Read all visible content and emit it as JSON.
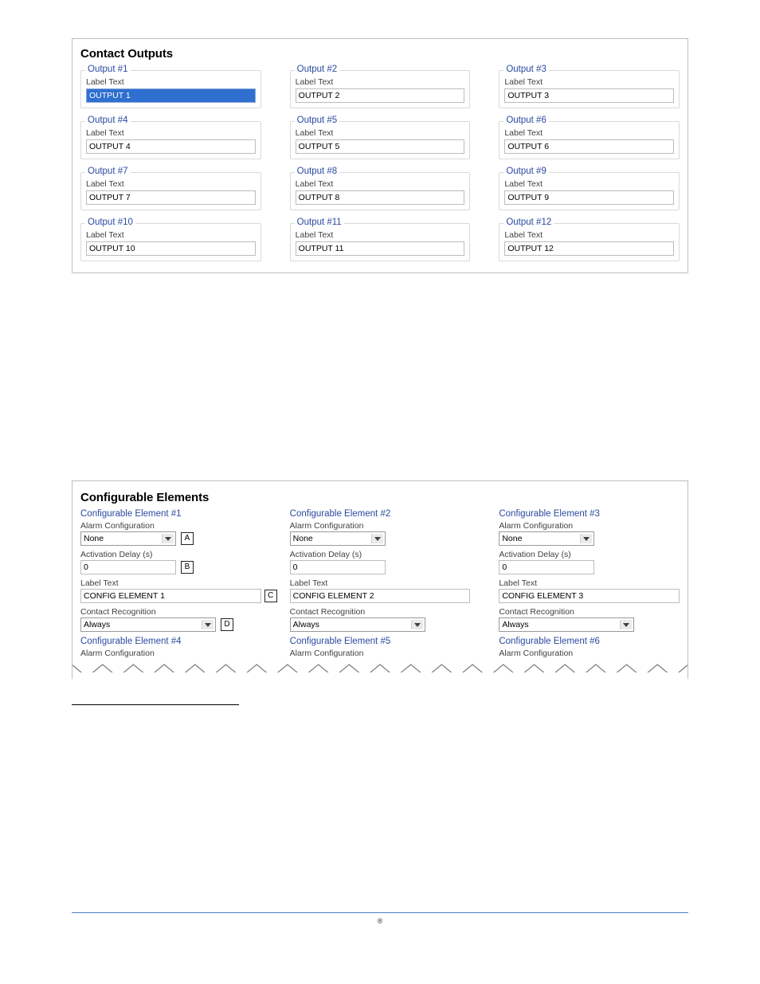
{
  "contact_outputs": {
    "title": "Contact Outputs",
    "outputs": [
      {
        "legend": "Output #1",
        "field_label": "Label Text",
        "value": "OUTPUT 1",
        "selected": true
      },
      {
        "legend": "Output #2",
        "field_label": "Label Text",
        "value": "OUTPUT 2",
        "selected": false
      },
      {
        "legend": "Output #3",
        "field_label": "Label Text",
        "value": "OUTPUT 3",
        "selected": false
      },
      {
        "legend": "Output #4",
        "field_label": "Label Text",
        "value": "OUTPUT 4",
        "selected": false
      },
      {
        "legend": "Output #5",
        "field_label": "Label Text",
        "value": "OUTPUT 5",
        "selected": false
      },
      {
        "legend": "Output #6",
        "field_label": "Label Text",
        "value": "OUTPUT 6",
        "selected": false
      },
      {
        "legend": "Output #7",
        "field_label": "Label Text",
        "value": "OUTPUT 7",
        "selected": false
      },
      {
        "legend": "Output #8",
        "field_label": "Label Text",
        "value": "OUTPUT 8",
        "selected": false
      },
      {
        "legend": "Output #9",
        "field_label": "Label Text",
        "value": "OUTPUT 9",
        "selected": false
      },
      {
        "legend": "Output #10",
        "field_label": "Label Text",
        "value": "OUTPUT 10",
        "selected": false
      },
      {
        "legend": "Output #11",
        "field_label": "Label Text",
        "value": "OUTPUT 11",
        "selected": false
      },
      {
        "legend": "Output #12",
        "field_label": "Label Text",
        "value": "OUTPUT 12",
        "selected": false
      }
    ]
  },
  "configurable_elements": {
    "title": "Configurable Elements",
    "labels": {
      "alarm_config": "Alarm Configuration",
      "activation_delay": "Activation Delay (s)",
      "label_text": "Label Text",
      "contact_recognition": "Contact Recognition"
    },
    "callouts": {
      "a": "A",
      "b": "B",
      "c": "C",
      "d": "D"
    },
    "elements": [
      {
        "title": "Configurable Element #1",
        "alarm": "None",
        "delay": "0",
        "label": "CONFIG ELEMENT 1",
        "contact": "Always"
      },
      {
        "title": "Configurable Element #2",
        "alarm": "None",
        "delay": "0",
        "label": "CONFIG ELEMENT 2",
        "contact": "Always"
      },
      {
        "title": "Configurable Element #3",
        "alarm": "None",
        "delay": "0",
        "label": "CONFIG ELEMENT 3",
        "contact": "Always"
      }
    ],
    "row2": [
      {
        "title": "Configurable Element #4",
        "sub": "Alarm Configuration"
      },
      {
        "title": "Configurable Element #5",
        "sub": "Alarm Configuration"
      },
      {
        "title": "Configurable Element #6",
        "sub": "Alarm Configuration"
      }
    ]
  },
  "footer": {
    "center_mark": "®"
  }
}
